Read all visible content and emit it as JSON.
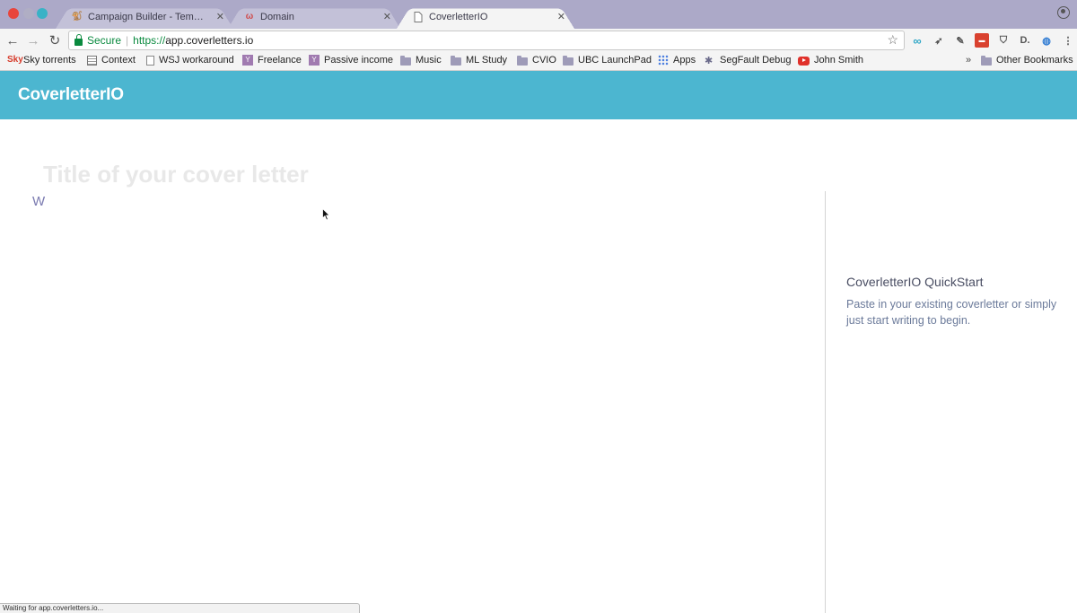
{
  "browser": {
    "tabs": [
      {
        "title": "Campaign Builder - Template"
      },
      {
        "title": "Domain"
      },
      {
        "title": "CoverletterIO"
      }
    ],
    "address": {
      "security_label": "Secure",
      "url_scheme": "https://",
      "url_host": "app.coverletters.io"
    },
    "bookmarks": [
      {
        "label": "Sky torrents"
      },
      {
        "label": "Context"
      },
      {
        "label": "WSJ workaround"
      },
      {
        "label": "Freelance"
      },
      {
        "label": "Passive income"
      },
      {
        "label": "Music"
      },
      {
        "label": "ML Study"
      },
      {
        "label": "CVIO"
      },
      {
        "label": "UBC LaunchPad"
      },
      {
        "label": "Apps"
      },
      {
        "label": "SegFault Debug"
      },
      {
        "label": "John Smith"
      }
    ],
    "overflow_label": "»",
    "other_bookmarks": "Other Bookmarks",
    "status_text": "Waiting for app.coverletters.io..."
  },
  "app": {
    "title": "CoverletterIO",
    "editor": {
      "title_placeholder": "Title of your cover letter",
      "body_text": "W"
    },
    "quickstart": {
      "title": "CoverletterIO QuickStart",
      "text": "Paste in your existing coverletter or simply just start writing to begin."
    }
  },
  "colors": {
    "header": "#4cb6d0",
    "tabstrip": "#aca9c8",
    "secure": "#0a8a3f"
  }
}
